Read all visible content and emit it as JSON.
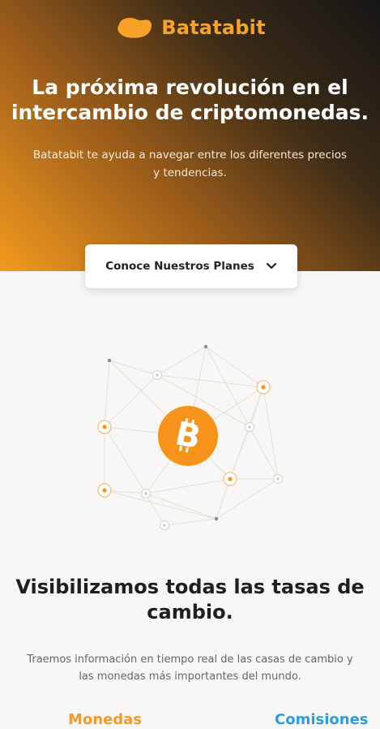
{
  "header": {
    "brand": "Batatabit",
    "logo_icon": "batata-logo-icon"
  },
  "hero": {
    "title": "La próxima revolución en el intercambio de criptomonedas.",
    "subtitle": "Batatabit te ayuda a navegar entre los diferentes precios y tendencias.",
    "plans_button": "Conoce Nuestros Planes",
    "plans_icon": "chevron-down-icon"
  },
  "illustration": {
    "icon": "bitcoin-network-icon"
  },
  "section": {
    "title": "Visibilizamos todas las tasas de cambio.",
    "text": "Traemos información en tiempo real de las casas de cambio y las monedas más importantes del mundo."
  },
  "tabs": {
    "monedas": "Monedas",
    "comisiones": "Comisiones"
  },
  "colors": {
    "accent": "#f7931a",
    "accent_light": "#f8a228",
    "link_blue": "#2e9ed8",
    "text_dark": "#1f1f1f"
  }
}
